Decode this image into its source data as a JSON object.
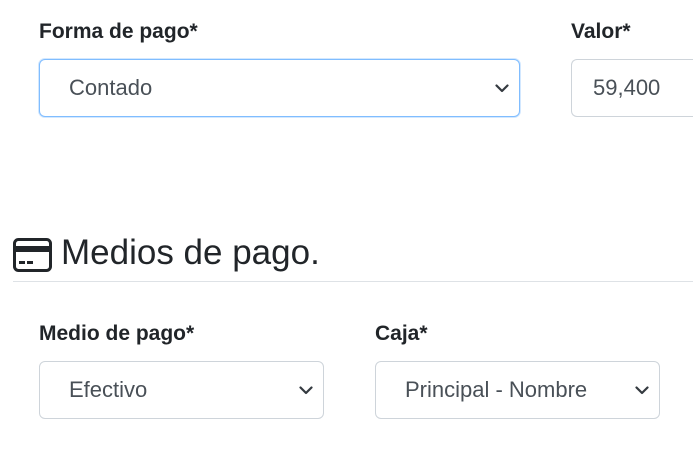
{
  "payment_form": {
    "forma_de_pago": {
      "label": "Forma de pago*",
      "selected": "Contado"
    },
    "valor": {
      "label": "Valor*",
      "value": "59,400"
    }
  },
  "medios_section": {
    "title": "Medios de pago.",
    "icon": "credit-card-icon",
    "medio_de_pago": {
      "label": "Medio de pago*",
      "selected": "Efectivo"
    },
    "caja": {
      "label": "Caja*",
      "selected": "Principal - Nombre"
    }
  },
  "colors": {
    "focus_border": "#80bdff",
    "border": "#ced4da",
    "text": "#212529",
    "field_text": "#495057"
  }
}
